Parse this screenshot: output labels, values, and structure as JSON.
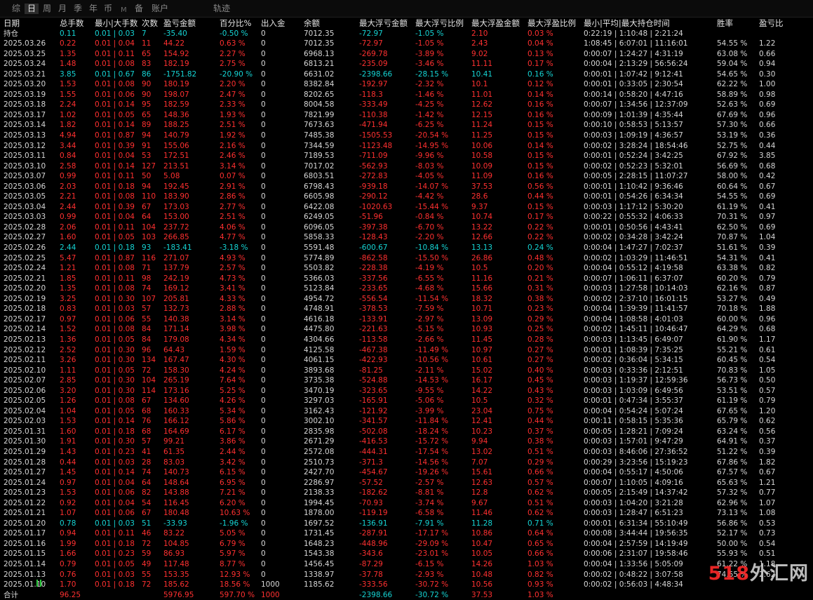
{
  "tabs": [
    {
      "label": "综",
      "dim": false,
      "active": false
    },
    {
      "label": "日",
      "dim": false,
      "active": true
    },
    {
      "label": "周",
      "dim": false,
      "active": false
    },
    {
      "label": "月",
      "dim": false,
      "active": false
    },
    {
      "label": "季",
      "dim": false,
      "active": false
    },
    {
      "label": "年",
      "dim": false,
      "active": false
    },
    {
      "label": "币",
      "dim": false,
      "active": false
    },
    {
      "label": "M",
      "dim": true,
      "active": false
    },
    {
      "label": "备",
      "dim": false,
      "active": false
    },
    {
      "label": "账户",
      "dim": false,
      "active": false
    },
    {
      "label": "轨迹",
      "dim": false,
      "active": false
    }
  ],
  "columns": [
    "日期",
    "总手数",
    "最小|大手数",
    "次数",
    "盈亏金额",
    "百分比%",
    "出入金",
    "余额",
    "最大浮亏金额",
    "最大浮亏比例",
    "最大浮盈金额",
    "最大浮盈比例",
    "最小|平均|最大持仓时间",
    "胜率",
    "盈亏比"
  ],
  "holding": {
    "label": "持仓",
    "lots": "0.11",
    "minmax": "0.01 | 0.03",
    "count": "7",
    "pnl": "-35.40",
    "pct": "-0.50 %",
    "io": "0",
    "balance": "7012.35",
    "dd": "-72.97",
    "ddp": "-1.05 %",
    "fu": "2.10",
    "fup": "0.03 %",
    "time": "0:22:19 | 1:10:48 | 2:21:24",
    "win": "",
    "pf": ""
  },
  "rows": [
    [
      "2025.03.26",
      "0.22",
      "0.01 | 0.04",
      "11",
      "44.22",
      "0.63 %",
      "0",
      "7012.35",
      "-72.97",
      "-1.05 %",
      "2.43",
      "0.04 %",
      "1:08:45 | 6:07:01 | 11:16:01",
      "54.55 %",
      "1.22"
    ],
    [
      "2025.03.25",
      "1.35",
      "0.01 | 0.11",
      "65",
      "154.92",
      "2.27 %",
      "0",
      "6968.13",
      "-269.78",
      "-3.89 %",
      "9.02",
      "0.13 %",
      "0:00:07 | 1:24:27 | 4:31:19",
      "63.08 %",
      "0.66"
    ],
    [
      "2025.03.24",
      "1.48",
      "0.01 | 0.08",
      "83",
      "182.19",
      "2.75 %",
      "0",
      "6813.21",
      "-235.09",
      "-3.46 %",
      "11.11",
      "0.17 %",
      "0:00:04 | 2:13:29 | 56:56:24",
      "59.04 %",
      "0.94"
    ],
    [
      "2025.03.21",
      "3.85",
      "0.01 | 0.67",
      "86",
      "-1751.82",
      "-20.90 %",
      "0",
      "6631.02",
      "-2398.66",
      "-28.15 %",
      "10.41",
      "0.16 %",
      "0:00:01 | 1:07:42 | 9:12:41",
      "54.65 %",
      "0.30"
    ],
    [
      "2025.03.20",
      "1.53",
      "0.01 | 0.08",
      "90",
      "180.19",
      "2.20 %",
      "0",
      "8382.84",
      "-192.97",
      "-2.32 %",
      "10.1",
      "0.12 %",
      "0:00:01 | 0:33:05 | 2:30:54",
      "62.22 %",
      "1.00"
    ],
    [
      "2025.03.19",
      "1.55",
      "0.01 | 0.06",
      "90",
      "198.07",
      "2.47 %",
      "0",
      "8202.65",
      "-118.3",
      "-1.46 %",
      "11.01",
      "0.14 %",
      "0:00:14 | 0:58:20 | 4:47:16",
      "58.89 %",
      "0.98"
    ],
    [
      "2025.03.18",
      "2.24",
      "0.01 | 0.14",
      "95",
      "182.59",
      "2.33 %",
      "0",
      "8004.58",
      "-333.49",
      "-4.25 %",
      "12.62",
      "0.16 %",
      "0:00:07 | 1:34:56 | 12:37:09",
      "52.63 %",
      "0.69"
    ],
    [
      "2025.03.17",
      "1.02",
      "0.01 | 0.05",
      "65",
      "148.36",
      "1.93 %",
      "0",
      "7821.99",
      "-110.38",
      "-1.42 %",
      "12.15",
      "0.16 %",
      "0:00:09 | 1:01:39 | 4:35:44",
      "67.69 %",
      "0.96"
    ],
    [
      "2025.03.14",
      "1.82",
      "0.01 | 0.14",
      "89",
      "188.25",
      "2.51 %",
      "0",
      "7673.63",
      "-471.94",
      "-6.25 %",
      "11.24",
      "0.15 %",
      "0:00:10 | 0:58:53 | 5:13:57",
      "57.30 %",
      "0.66"
    ],
    [
      "2025.03.13",
      "4.94",
      "0.01 | 0.87",
      "94",
      "140.79",
      "1.92 %",
      "0",
      "7485.38",
      "-1505.53",
      "-20.54 %",
      "11.25",
      "0.15 %",
      "0:00:03 | 1:09:19 | 4:36:57",
      "53.19 %",
      "0.36"
    ],
    [
      "2025.03.12",
      "3.44",
      "0.01 | 0.39",
      "91",
      "155.06",
      "2.16 %",
      "0",
      "7344.59",
      "-1123.48",
      "-14.95 %",
      "10.06",
      "0.14 %",
      "0:00:02 | 3:28:24 | 18:54:46",
      "52.75 %",
      "0.44"
    ],
    [
      "2025.03.11",
      "0.84",
      "0.01 | 0.04",
      "53",
      "172.51",
      "2.46 %",
      "0",
      "7189.53",
      "-711.09",
      "-9.96 %",
      "10.58",
      "0.15 %",
      "0:00:01 | 0:52:24 | 3:42:25",
      "67.92 %",
      "3.85"
    ],
    [
      "2025.03.10",
      "2.58",
      "0.01 | 0.14",
      "127",
      "213.51",
      "3.14 %",
      "0",
      "7017.02",
      "-562.93",
      "-8.03 %",
      "10.09",
      "0.15 %",
      "0:00:02 | 0:52:23 | 5:32:01",
      "56.69 %",
      "0.68"
    ],
    [
      "2025.03.07",
      "0.99",
      "0.01 | 0.11",
      "50",
      "5.08",
      "0.07 %",
      "0",
      "6803.51",
      "-272.83",
      "-4.05 %",
      "11.09",
      "0.16 %",
      "0:00:05 | 2:28:15 | 11:07:27",
      "58.00 %",
      "0.42"
    ],
    [
      "2025.03.06",
      "2.03",
      "0.01 | 0.18",
      "94",
      "192.45",
      "2.91 %",
      "0",
      "6798.43",
      "-939.18",
      "-14.07 %",
      "37.53",
      "0.56 %",
      "0:00:01 | 1:10:42 | 9:36:46",
      "60.64 %",
      "0.67"
    ],
    [
      "2025.03.05",
      "2.21",
      "0.01 | 0.08",
      "110",
      "183.90",
      "2.86 %",
      "0",
      "6605.98",
      "-290.12",
      "-4.42 %",
      "28.6",
      "0.44 %",
      "0:00:01 | 0:54:26 | 6:34:34",
      "54.55 %",
      "0.69"
    ],
    [
      "2025.03.04",
      "2.44",
      "0.01 | 0.39",
      "67",
      "173.03",
      "2.77 %",
      "0",
      "6422.08",
      "-1020.63",
      "-15.44 %",
      "9.37",
      "0.15 %",
      "0:00:03 | 1:17:12 | 5:30:20",
      "61.19 %",
      "0.41"
    ],
    [
      "2025.03.03",
      "0.99",
      "0.01 | 0.04",
      "64",
      "153.00",
      "2.51 %",
      "0",
      "6249.05",
      "-51.96",
      "-0.84 %",
      "10.74",
      "0.17 %",
      "0:00:22 | 0:55:32 | 4:06:33",
      "70.31 %",
      "0.97"
    ],
    [
      "2025.02.28",
      "2.06",
      "0.01 | 0.11",
      "104",
      "237.72",
      "4.06 %",
      "0",
      "6096.05",
      "-397.38",
      "-6.70 %",
      "13.22",
      "0.22 %",
      "0:00:01 | 0:50:56 | 4:43:41",
      "62.50 %",
      "0.69"
    ],
    [
      "2025.02.27",
      "1.60",
      "0.01 | 0.05",
      "103",
      "266.85",
      "4.77 %",
      "0",
      "5858.33",
      "-128.43",
      "-2.20 %",
      "12.66",
      "0.22 %",
      "0:00:02 | 0:34:28 | 3:42:24",
      "70.87 %",
      "1.04"
    ],
    [
      "2025.02.26",
      "2.44",
      "0.01 | 0.18",
      "93",
      "-183.41",
      "-3.18 %",
      "0",
      "5591.48",
      "-600.67",
      "-10.84 %",
      "13.13",
      "0.24 %",
      "0:00:04 | 1:47:27 | 7:02:37",
      "51.61 %",
      "0.39"
    ],
    [
      "2025.02.25",
      "5.47",
      "0.01 | 0.87",
      "116",
      "271.07",
      "4.93 %",
      "0",
      "5774.89",
      "-862.58",
      "-15.50 %",
      "26.86",
      "0.48 %",
      "0:00:02 | 1:03:29 | 11:46:51",
      "54.31 %",
      "0.41"
    ],
    [
      "2025.02.24",
      "1.21",
      "0.01 | 0.08",
      "71",
      "137.79",
      "2.57 %",
      "0",
      "5503.82",
      "-228.38",
      "-4.19 %",
      "10.5",
      "0.20 %",
      "0:00:04 | 0:55:12 | 4:19:58",
      "63.38 %",
      "0.82"
    ],
    [
      "2025.02.21",
      "1.85",
      "0.01 | 0.11",
      "98",
      "242.19",
      "4.73 %",
      "0",
      "5366.03",
      "-337.56",
      "-6.55 %",
      "11.16",
      "0.21 %",
      "0:00:07 | 1:06:11 | 6:37:07",
      "60.20 %",
      "0.79"
    ],
    [
      "2025.02.20",
      "1.35",
      "0.01 | 0.08",
      "74",
      "169.12",
      "3.41 %",
      "0",
      "5123.84",
      "-233.65",
      "-4.68 %",
      "15.66",
      "0.31 %",
      "0:00:03 | 1:27:58 | 10:14:03",
      "62.16 %",
      "0.87"
    ],
    [
      "2025.02.19",
      "3.25",
      "0.01 | 0.30",
      "107",
      "205.81",
      "4.33 %",
      "0",
      "4954.72",
      "-556.54",
      "-11.54 %",
      "18.32",
      "0.38 %",
      "0:00:02 | 2:37:10 | 16:01:15",
      "53.27 %",
      "0.49"
    ],
    [
      "2025.02.18",
      "0.83",
      "0.01 | 0.03",
      "57",
      "132.73",
      "2.88 %",
      "0",
      "4748.91",
      "-378.53",
      "-7.59 %",
      "10.71",
      "0.23 %",
      "0:00:04 | 1:39:39 | 11:41:57",
      "70.18 %",
      "1.88"
    ],
    [
      "2025.02.17",
      "0.97",
      "0.01 | 0.06",
      "55",
      "140.38",
      "3.14 %",
      "0",
      "4616.18",
      "-133.91",
      "-2.97 %",
      "13.09",
      "0.29 %",
      "0:00:04 | 1:08:58 | 4:01:03",
      "60.00 %",
      "0.96"
    ],
    [
      "2025.02.14",
      "1.52",
      "0.01 | 0.08",
      "84",
      "171.14",
      "3.98 %",
      "0",
      "4475.80",
      "-221.63",
      "-5.15 %",
      "10.93",
      "0.25 %",
      "0:00:02 | 1:45:11 | 10:46:47",
      "64.29 %",
      "0.68"
    ],
    [
      "2025.02.13",
      "1.36",
      "0.01 | 0.05",
      "84",
      "179.08",
      "4.34 %",
      "0",
      "4304.66",
      "-113.58",
      "-2.66 %",
      "11.45",
      "0.28 %",
      "0:00:03 | 1:13:45 | 6:49:07",
      "61.90 %",
      "1.17"
    ],
    [
      "2025.02.12",
      "2.52",
      "0.01 | 0.30",
      "96",
      "64.43",
      "1.59 %",
      "0",
      "4125.58",
      "-467.38",
      "-11.49 %",
      "10.97",
      "0.27 %",
      "0:00:01 | 1:08:39 | 7:35:25",
      "55.21 %",
      "0.61"
    ],
    [
      "2025.02.11",
      "3.26",
      "0.01 | 0.30",
      "134",
      "167.47",
      "4.30 %",
      "0",
      "4061.15",
      "-422.93",
      "-10.56 %",
      "10.61",
      "0.27 %",
      "0:00:02 | 0:36:04 | 5:34:15",
      "60.45 %",
      "0.54"
    ],
    [
      "2025.02.10",
      "1.11",
      "0.01 | 0.05",
      "72",
      "158.30",
      "4.24 %",
      "0",
      "3893.68",
      "-81.25",
      "-2.11 %",
      "15.02",
      "0.40 %",
      "0:00:03 | 0:33:36 | 2:12:51",
      "70.83 %",
      "1.05"
    ],
    [
      "2025.02.07",
      "2.85",
      "0.01 | 0.30",
      "104",
      "265.19",
      "7.64 %",
      "0",
      "3735.38",
      "-524.88",
      "-14.53 %",
      "16.17",
      "0.45 %",
      "0:00:03 | 1:19:37 | 12:59:36",
      "56.73 %",
      "0.50"
    ],
    [
      "2025.02.06",
      "3.20",
      "0.01 | 0.30",
      "114",
      "173.16",
      "5.25 %",
      "0",
      "3470.19",
      "-323.65",
      "-9.55 %",
      "14.22",
      "0.43 %",
      "0:00:03 | 1:03:09 | 6:49:56",
      "53.51 %",
      "0.57"
    ],
    [
      "2025.02.05",
      "1.26",
      "0.01 | 0.08",
      "67",
      "134.60",
      "4.26 %",
      "0",
      "3297.03",
      "-165.91",
      "-5.06 %",
      "10.5",
      "0.32 %",
      "0:00:01 | 0:47:34 | 3:55:37",
      "61.19 %",
      "0.79"
    ],
    [
      "2025.02.04",
      "1.04",
      "0.01 | 0.05",
      "68",
      "160.33",
      "5.34 %",
      "0",
      "3162.43",
      "-121.92",
      "-3.99 %",
      "23.04",
      "0.75 %",
      "0:00:04 | 0:54:24 | 5:07:24",
      "67.65 %",
      "1.20"
    ],
    [
      "2025.02.03",
      "1.53",
      "0.01 | 0.14",
      "76",
      "166.12",
      "5.86 %",
      "0",
      "3002.10",
      "-341.57",
      "-11.84 %",
      "12.41",
      "0.44 %",
      "0:00:11 | 0:58:15 | 5:35:36",
      "65.79 %",
      "0.62"
    ],
    [
      "2025.01.31",
      "1.60",
      "0.01 | 0.18",
      "68",
      "164.69",
      "6.17 %",
      "0",
      "2835.98",
      "-502.08",
      "-18.24 %",
      "10.23",
      "0.37 %",
      "0:00:05 | 1:28:21 | 7:09:24",
      "63.24 %",
      "0.56"
    ],
    [
      "2025.01.30",
      "1.91",
      "0.01 | 0.30",
      "57",
      "99.21",
      "3.86 %",
      "0",
      "2671.29",
      "-416.53",
      "-15.72 %",
      "9.94",
      "0.38 %",
      "0:00:03 | 1:57:01 | 9:47:29",
      "64.91 %",
      "0.37"
    ],
    [
      "2025.01.29",
      "1.43",
      "0.01 | 0.23",
      "41",
      "61.35",
      "2.44 %",
      "0",
      "2572.08",
      "-444.31",
      "-17.54 %",
      "13.02",
      "0.51 %",
      "0:00:03 | 8:46:06 | 27:36:52",
      "51.22 %",
      "0.39"
    ],
    [
      "2025.01.28",
      "0.44",
      "0.01 | 0.03",
      "28",
      "83.03",
      "3.42 %",
      "0",
      "2510.73",
      "-371.3",
      "-14.56 %",
      "7.07",
      "0.29 %",
      "0:00:29 | 3:23:56 | 15:19:23",
      "67.86 %",
      "1.82"
    ],
    [
      "2025.01.27",
      "1.45",
      "0.01 | 0.14",
      "74",
      "140.73",
      "6.15 %",
      "0",
      "2427.70",
      "-454.67",
      "-19.26 %",
      "15.61",
      "0.66 %",
      "0:00:04 | 0:55:17 | 4:50:06",
      "67.57 %",
      "0.67"
    ],
    [
      "2025.01.24",
      "0.97",
      "0.01 | 0.04",
      "64",
      "148.64",
      "6.95 %",
      "0",
      "2286.97",
      "-57.52",
      "-2.57 %",
      "12.63",
      "0.57 %",
      "0:00:07 | 1:10:05 | 4:09:16",
      "65.63 %",
      "1.21"
    ],
    [
      "2025.01.23",
      "1.53",
      "0.01 | 0.06",
      "82",
      "143.88",
      "7.21 %",
      "0",
      "2138.33",
      "-182.62",
      "-8.81 %",
      "12.8",
      "0.62 %",
      "0:00:05 | 2:15:49 | 14:37:42",
      "57.32 %",
      "0.77"
    ],
    [
      "2025.01.22",
      "0.92",
      "0.01 | 0.04",
      "54",
      "116.45",
      "6.20 %",
      "0",
      "1994.45",
      "-70.93",
      "-3.74 %",
      "9.67",
      "0.51 %",
      "0:00:03 | 1:04:20 | 3:21:28",
      "62.96 %",
      "1.07"
    ],
    [
      "2025.01.21",
      "1.07",
      "0.01 | 0.06",
      "67",
      "180.48",
      "10.63 %",
      "0",
      "1878.00",
      "-119.19",
      "-6.58 %",
      "11.46",
      "0.62 %",
      "0:00:03 | 1:28:47 | 6:51:23",
      "73.13 %",
      "1.08"
    ],
    [
      "2025.01.20",
      "0.78",
      "0.01 | 0.03",
      "51",
      "-33.93",
      "-1.96 %",
      "0",
      "1697.52",
      "-136.91",
      "-7.91 %",
      "11.28",
      "0.71 %",
      "0:00:01 | 6:31:34 | 55:10:49",
      "56.86 %",
      "0.53"
    ],
    [
      "2025.01.17",
      "0.94",
      "0.01 | 0.11",
      "46",
      "83.22",
      "5.05 %",
      "0",
      "1731.45",
      "-287.91",
      "-17.17 %",
      "10.86",
      "0.64 %",
      "0:00:08 | 3:44:44 | 19:56:35",
      "52.17 %",
      "0.73"
    ],
    [
      "2025.01.16",
      "1.99",
      "0.01 | 0.18",
      "72",
      "104.85",
      "6.79 %",
      "0",
      "1648.23",
      "-448.96",
      "-29.09 %",
      "10.47",
      "0.65 %",
      "0:00:04 | 2:57:59 | 14:19:49",
      "50.00 %",
      "0.54"
    ],
    [
      "2025.01.15",
      "1.66",
      "0.01 | 0.23",
      "59",
      "86.93",
      "5.97 %",
      "0",
      "1543.38",
      "-343.6",
      "-23.01 %",
      "10.05",
      "0.66 %",
      "0:00:06 | 2:31:07 | 19:58:46",
      "55.93 %",
      "0.51"
    ],
    [
      "2025.01.14",
      "0.79",
      "0.01 | 0.05",
      "49",
      "117.48",
      "8.77 %",
      "0",
      "1456.45",
      "-87.29",
      "-6.15 %",
      "14.26",
      "1.03 %",
      "0:00:04 | 1:33:56 | 5:05:09",
      "61.22 %",
      "1.18"
    ],
    [
      "2025.01.13",
      "0.76",
      "0.01 | 0.03",
      "55",
      "153.35",
      "12.93 %",
      "0",
      "1338.97",
      "-37.78",
      "-2.93 %",
      "10.48",
      "0.82 %",
      "0:00:02 | 0:48:22 | 3:07:58",
      "74.55 %",
      "2.62"
    ],
    [
      "2025.01.10",
      "1.70",
      "0.01 | 0.18",
      "72",
      "185.62",
      "18.56 %",
      "1000",
      "1185.62",
      "-333.56",
      "-30.72 %",
      "10.56",
      "0.93 %",
      "0:00:02 | 0:56:03 | 4:48:34",
      "",
      ""
    ]
  ],
  "total": {
    "label": "合计",
    "lots": "96.25",
    "minmax": "",
    "count": "",
    "pnl": "5976.95",
    "pct": "597.70 %",
    "io": "1000",
    "balance": "",
    "dd": "-2398.66",
    "ddp": "-30.72 %",
    "fu": "37.53",
    "fup": "1.03 %",
    "time": "",
    "win": "",
    "pf": ""
  },
  "watermark": {
    "digits": "518",
    "text": "外汇网"
  },
  "colors": {
    "profit": "#ff3030",
    "loss": "#15d4d4",
    "text": "#d6d6d6",
    "background": "#000000"
  }
}
